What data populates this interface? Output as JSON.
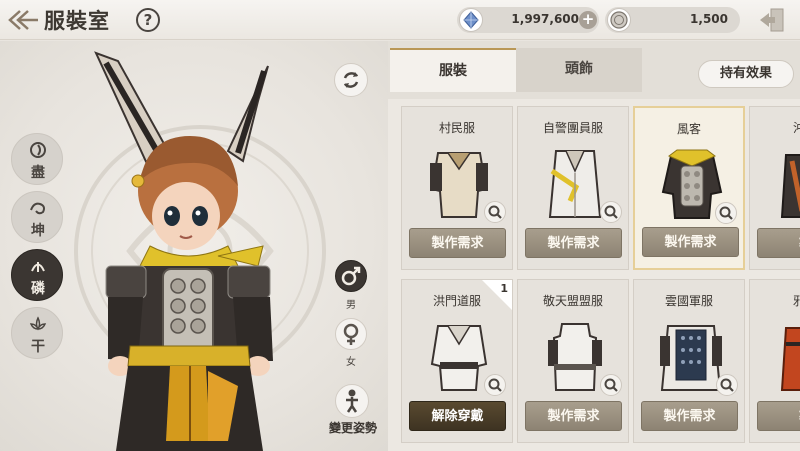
{
  "header": {
    "title": "服裝室",
    "help_label": "?",
    "currencies": [
      {
        "icon": "blue-gem-icon",
        "value": "1,997,600",
        "has_plus": true
      },
      {
        "icon": "silver-coin-icon",
        "value": "1,500",
        "has_plus": false
      }
    ]
  },
  "elements": [
    {
      "label": "盡",
      "icon": "swirl-icon",
      "active": false
    },
    {
      "label": "坤",
      "icon": "dragon-icon",
      "active": false
    },
    {
      "label": "磷",
      "icon": "spirit-icon",
      "active": true
    },
    {
      "label": "干",
      "icon": "lotus-icon",
      "active": false
    }
  ],
  "gender": {
    "male_label": "男",
    "female_label": "女",
    "selected": "male"
  },
  "pose": {
    "label": "變更姿勢"
  },
  "tabs": [
    {
      "label": "服裝",
      "active": true
    },
    {
      "label": "頭飾",
      "active": false
    }
  ],
  "effect_button": "持有效果",
  "costumes": [
    {
      "name": "村民服",
      "button": "製作需求",
      "selected": false,
      "equipped": false,
      "badge": ""
    },
    {
      "name": "自警團員服",
      "button": "製作需求",
      "selected": false,
      "equipped": false,
      "badge": ""
    },
    {
      "name": "風客",
      "button": "製作需求",
      "selected": true,
      "equipped": false,
      "badge": ""
    },
    {
      "name": "沖角",
      "button": "製",
      "selected": false,
      "equipped": false,
      "badge": ""
    },
    {
      "name": "洪門道服",
      "button": "解除穿戴",
      "selected": false,
      "equipped": true,
      "badge": "1"
    },
    {
      "name": "敬天盟盟服",
      "button": "製作需求",
      "selected": false,
      "equipped": false,
      "badge": ""
    },
    {
      "name": "雲國軍服",
      "button": "製作需求",
      "selected": false,
      "equipped": false,
      "badge": ""
    },
    {
      "name": "邪魔",
      "button": "製",
      "selected": false,
      "equipped": false,
      "badge": ""
    }
  ],
  "colors": {
    "accent_gold": "#b99756",
    "button_brown": "#8d8373",
    "equipped_dark": "#3e3322"
  }
}
